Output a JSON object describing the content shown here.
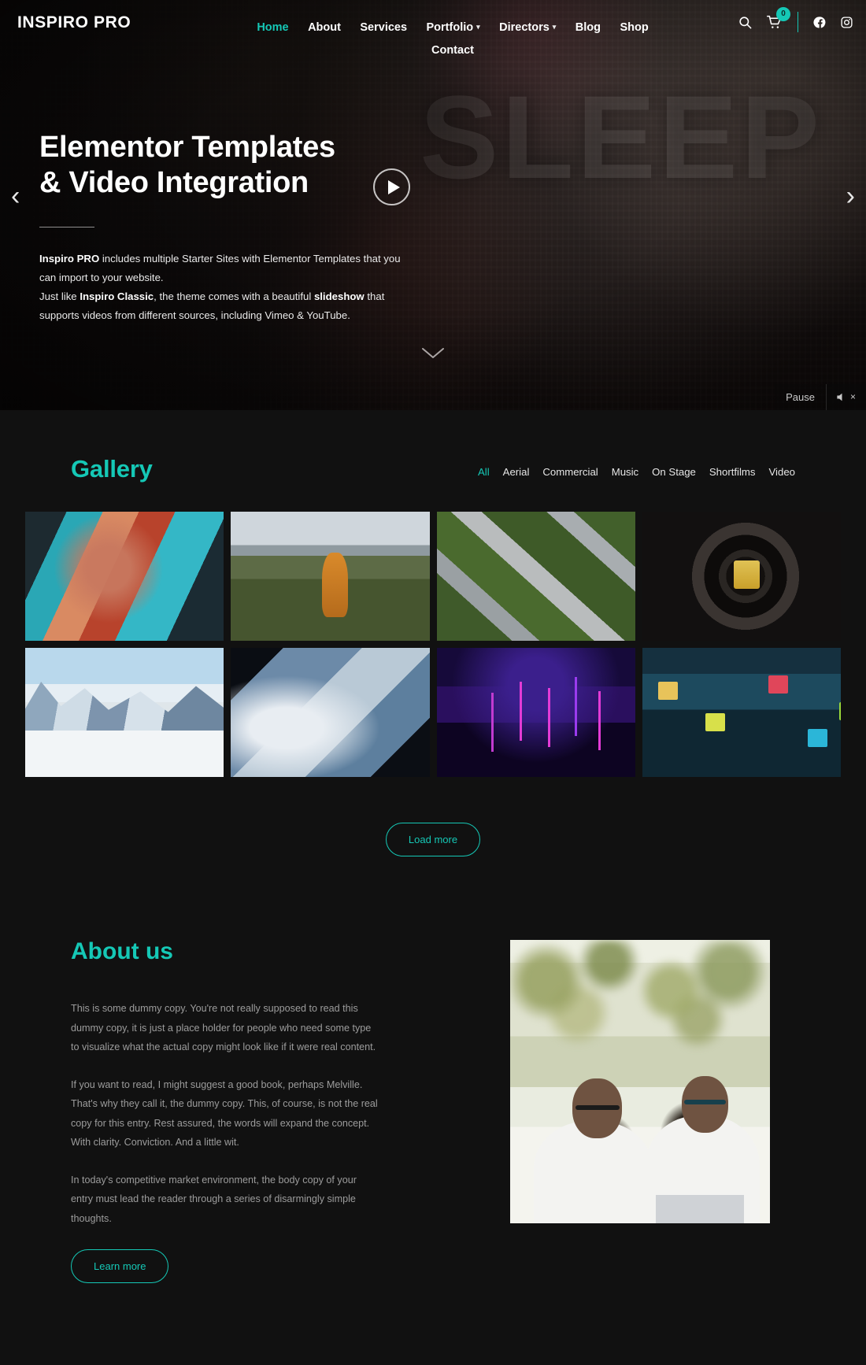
{
  "site": {
    "brand": "INSPIRO PRO",
    "accent": "#15c8b6",
    "background": "#111111"
  },
  "header": {
    "nav_row1": [
      {
        "label": "Home",
        "active": true,
        "has_caret": false
      },
      {
        "label": "About",
        "active": false,
        "has_caret": false
      },
      {
        "label": "Services",
        "active": false,
        "has_caret": false
      },
      {
        "label": "Portfolio",
        "active": false,
        "has_caret": true
      },
      {
        "label": "Directors",
        "active": false,
        "has_caret": true
      },
      {
        "label": "Blog",
        "active": false,
        "has_caret": false
      },
      {
        "label": "Shop",
        "active": false,
        "has_caret": false
      }
    ],
    "nav_row2": [
      {
        "label": "Contact",
        "active": false,
        "has_caret": false
      }
    ],
    "icons": {
      "search": "search-icon",
      "cart": "cart-icon",
      "cart_count": "0",
      "facebook": "facebook-icon",
      "instagram": "instagram-icon"
    }
  },
  "hero": {
    "title_line1": "Elementor Templates",
    "title_line2": "& Video Integration",
    "desc_line1_bold": "Inspiro PRO",
    "desc_line1_rest": " includes multiple Starter Sites with Elementor Templates that you can import to your website.",
    "desc_line2_pre": "Just like ",
    "desc_line2_bold1": "Inspiro Classic",
    "desc_line2_mid": ", the theme comes with a beautiful ",
    "desc_line2_bold2": "slideshow",
    "desc_line2_rest": " that supports videos from different sources, including Vimeo & YouTube.",
    "background_word": "SLEEP",
    "prev_arrow": "‹",
    "next_arrow": "›",
    "play_label": "play-button",
    "scroll_hint": "scroll-down-chevron",
    "pause_label": "Pause",
    "mute_label": "muted"
  },
  "gallery": {
    "title": "Gallery",
    "filters": [
      {
        "label": "All",
        "active": true
      },
      {
        "label": "Aerial",
        "active": false
      },
      {
        "label": "Commercial",
        "active": false
      },
      {
        "label": "Music",
        "active": false
      },
      {
        "label": "On Stage",
        "active": false
      },
      {
        "label": "Shortfilms",
        "active": false
      },
      {
        "label": "Video",
        "active": false
      }
    ],
    "items": [
      {
        "alt": "woman in red dress against teal wall"
      },
      {
        "alt": "woman in orange coat walking through field"
      },
      {
        "alt": "aerial view of highway interchange"
      },
      {
        "alt": "close-up of Porsche alloy wheel"
      },
      {
        "alt": "snowy mountain valley"
      },
      {
        "alt": "earth seen from orbit"
      },
      {
        "alt": "concert crowd with neon lights"
      },
      {
        "alt": "neon lit alley at night"
      }
    ],
    "load_more_label": "Load more"
  },
  "about": {
    "title": "About us",
    "paragraphs": [
      "This is some dummy copy. You're not really supposed to read this dummy copy, it is just a place holder for people who need some type to visualize what the actual copy might look like if it were real content.",
      "If you want to read, I might suggest a good book, perhaps Melville. That's why they call it, the dummy copy. This, of course, is not the real copy for this entry. Rest assured, the words will expand the concept. With clarity. Conviction. And a little wit.",
      "In today's competitive market environment, the body copy of your entry must lead the reader through a series of disarmingly simple thoughts."
    ],
    "button_label": "Learn more",
    "photo_alt": "two men with sunglasses at a laptop outdoors"
  }
}
